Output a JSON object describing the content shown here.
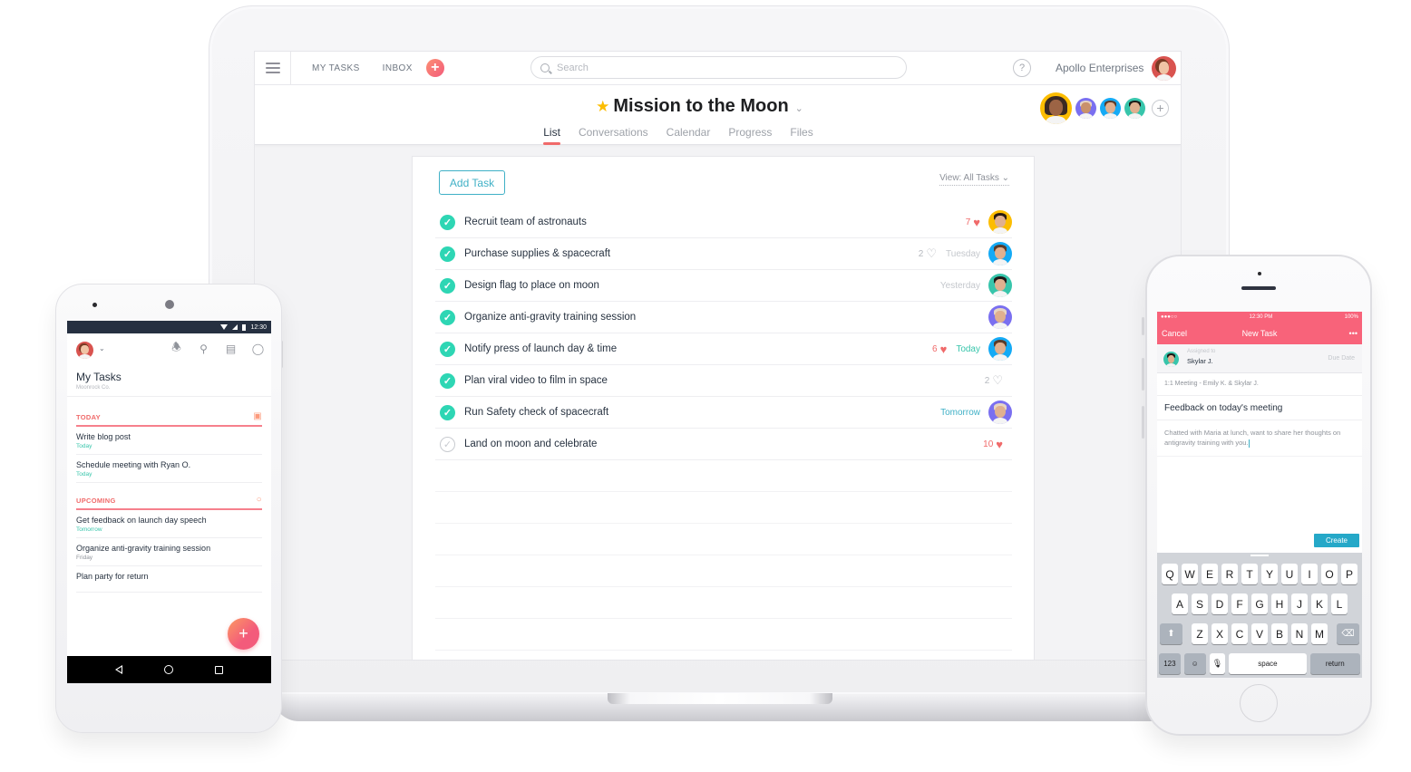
{
  "desktop": {
    "nav": {
      "menu_icon": "hamburger-icon",
      "links": [
        "MY TASKS",
        "INBOX"
      ],
      "add_button": "+",
      "search_placeholder": "Search",
      "help_label": "?",
      "organization": "Apollo Enterprises"
    },
    "project": {
      "title": "Mission to the Moon",
      "favorite_icon": "star-icon",
      "tabs": [
        {
          "label": "List",
          "active": true
        },
        {
          "label": "Conversations",
          "active": false
        },
        {
          "label": "Calendar",
          "active": false
        },
        {
          "label": "Progress",
          "active": false
        },
        {
          "label": "Files",
          "active": false
        }
      ],
      "add_member_label": "+"
    },
    "task_panel": {
      "add_task_label": "Add Task",
      "view_filter": "View: All Tasks ⌄",
      "tasks": [
        {
          "name": "Recruit team of astronauts",
          "completed": true,
          "likes": "7",
          "liked": true,
          "due": "",
          "assignee": true
        },
        {
          "name": "Purchase supplies & spacecraft",
          "completed": true,
          "likes": "2",
          "liked": false,
          "due": "Tuesday",
          "due_style": "gray",
          "assignee": true
        },
        {
          "name": "Design flag to place on moon",
          "completed": true,
          "likes": "",
          "liked": false,
          "due": "Yesterday",
          "due_style": "gray",
          "assignee": true
        },
        {
          "name": "Organize anti-gravity training session",
          "completed": true,
          "likes": "",
          "liked": false,
          "due": "",
          "assignee": true
        },
        {
          "name": "Notify press of launch day & time",
          "completed": true,
          "likes": "6",
          "liked": true,
          "due": "Today",
          "due_style": "teal",
          "assignee": true
        },
        {
          "name": "Plan viral video to film in space",
          "completed": true,
          "likes": "2",
          "liked": false,
          "due": "",
          "assignee": false
        },
        {
          "name": "Run Safety check of spacecraft",
          "completed": true,
          "likes": "",
          "liked": false,
          "due": "Tomorrow",
          "due_style": "blue",
          "assignee": true
        },
        {
          "name": "Land on moon and celebrate",
          "completed": false,
          "likes": "10",
          "liked": true,
          "due": "",
          "assignee": false
        }
      ]
    }
  },
  "android": {
    "status_time": "12:30",
    "title": "My Tasks",
    "subtitle": "Moonrock Co.",
    "sections": [
      {
        "label": "TODAY",
        "icon": "calendar-icon",
        "items": [
          {
            "name": "Write blog post",
            "date": "Today",
            "date_style": "teal"
          },
          {
            "name": "Schedule meeting with Ryan O.",
            "date": "Today",
            "date_style": "teal"
          }
        ]
      },
      {
        "label": "UPCOMING",
        "icon": "circle-icon",
        "items": [
          {
            "name": "Get feedback on launch day speech",
            "date": "Tomorrow",
            "date_style": "teal"
          },
          {
            "name": "Organize anti-gravity training session",
            "date": "Friday",
            "date_style": "gray"
          },
          {
            "name": "Plan party for return",
            "date": "",
            "date_style": "gray"
          }
        ]
      }
    ],
    "fab_label": "+"
  },
  "iphone": {
    "status": {
      "signal": "●●●○○",
      "time": "12:30 PM",
      "battery": "100%"
    },
    "nav": {
      "cancel": "Cancel",
      "title": "New Task",
      "more": "•••"
    },
    "assigned_label": "Assigned to",
    "assignee": "Skylar J.",
    "due_date_label": "Due Date",
    "project": "1:1 Meeting - Emily K. & Skylar J.",
    "task_name": "Feedback on today's meeting",
    "description": "Chatted with Maria at lunch, want to share her thoughts on antigravity training with you.",
    "create_label": "Create",
    "keyboard": {
      "row1": [
        "Q",
        "W",
        "E",
        "R",
        "T",
        "Y",
        "U",
        "I",
        "O",
        "P"
      ],
      "row2": [
        "A",
        "S",
        "D",
        "F",
        "G",
        "H",
        "J",
        "K",
        "L"
      ],
      "row3": [
        "Z",
        "X",
        "C",
        "V",
        "B",
        "N",
        "M"
      ],
      "numbers": "123",
      "space": "space",
      "return": "return"
    }
  },
  "colors": {
    "accent_red": "#f06a6a",
    "check_teal": "#2ed6b4",
    "link_blue": "#3fb0c6",
    "ios_bar": "#f8637a",
    "android_status": "#263041"
  }
}
